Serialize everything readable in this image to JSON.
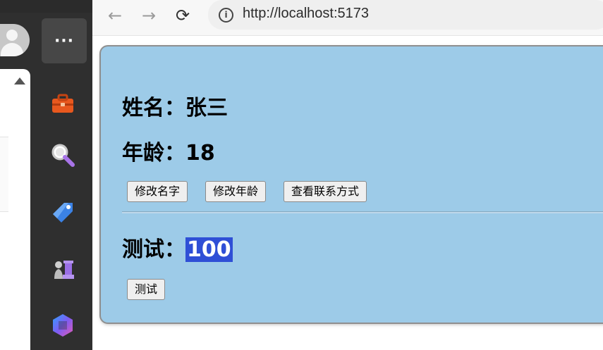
{
  "browser": {
    "url": "http://localhost:5173",
    "back_glyph": "←",
    "forward_glyph": "→",
    "reload_glyph": "⟳",
    "info_glyph": "i"
  },
  "sidebar": {
    "more_label": "···",
    "icons": [
      "toolbox-icon",
      "search-icon",
      "tag-icon",
      "chess-icon",
      "copilot-icon"
    ]
  },
  "content": {
    "name_line": {
      "label": "姓名：",
      "value": "张三"
    },
    "age_line": {
      "label": "年龄：",
      "value": "18"
    },
    "buttons": [
      "修改名字",
      "修改年龄",
      "查看联系方式"
    ],
    "test_line": {
      "label": "测试：",
      "value": "100"
    },
    "test_button": "测试"
  },
  "colors": {
    "card_bg": "#9dcbe8",
    "highlight": "#2f4fd6",
    "sidebar_bg": "#2f2f2f"
  }
}
